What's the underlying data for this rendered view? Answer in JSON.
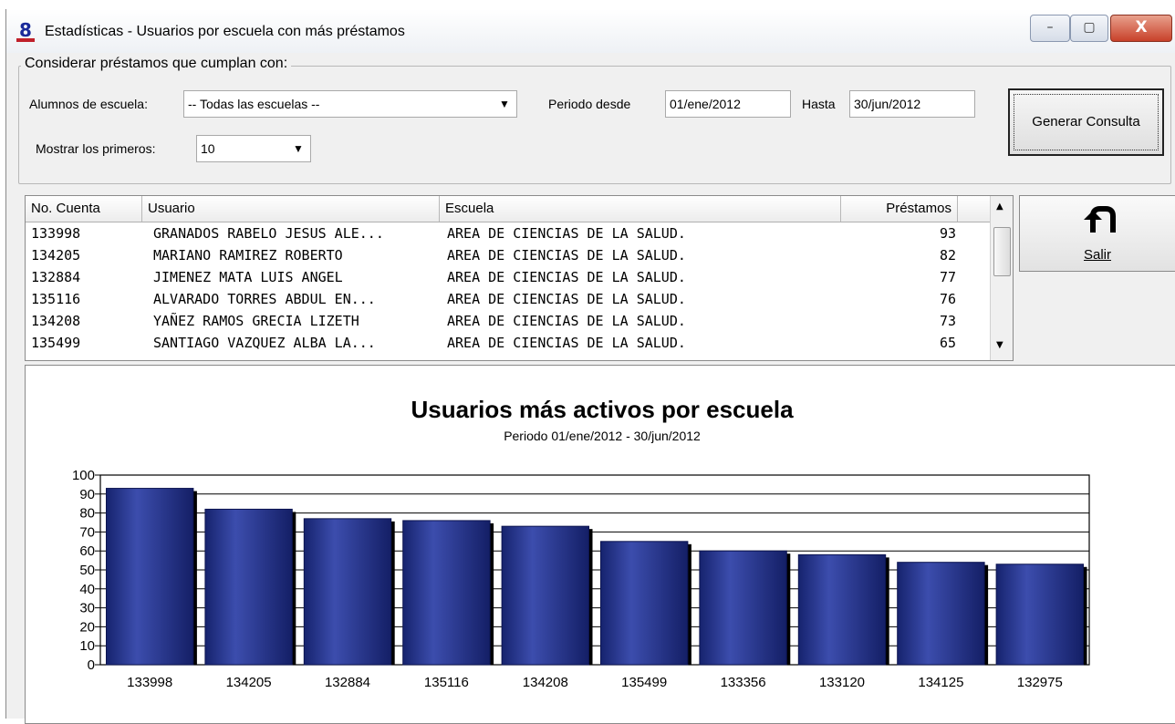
{
  "window": {
    "title": "Estadísticas - Usuarios por escuela con más préstamos",
    "minimize": "–",
    "maximize": "▢",
    "close": "X"
  },
  "filters": {
    "group_label": "Considerar préstamos que cumplan con:",
    "school_label": "Alumnos de escuela:",
    "school_value": "-- Todas las escuelas --",
    "period_from_label": "Periodo desde",
    "period_from_value": "01/ene/2012",
    "to_label": "Hasta",
    "to_value": "30/jun/2012",
    "show_first_label": "Mostrar los primeros:",
    "show_first_value": "10",
    "generate_button": "Generar Consulta"
  },
  "grid": {
    "columns": [
      "No. Cuenta",
      "Usuario",
      "Escuela",
      "Préstamos"
    ],
    "rows": [
      [
        "133998",
        "GRANADOS RABELO JESUS ALE...",
        "AREA DE CIENCIAS DE LA SALUD.",
        "93"
      ],
      [
        "134205",
        "MARIANO RAMIREZ ROBERTO",
        "AREA DE CIENCIAS DE LA SALUD.",
        "82"
      ],
      [
        "132884",
        "JIMENEZ MATA LUIS ANGEL",
        "AREA DE CIENCIAS DE LA SALUD.",
        "77"
      ],
      [
        "135116",
        "ALVARADO TORRES ABDUL EN...",
        "AREA DE CIENCIAS DE LA SALUD.",
        "76"
      ],
      [
        "134208",
        "YAÑEZ RAMOS GRECIA LIZETH",
        "AREA DE CIENCIAS DE LA SALUD.",
        "73"
      ],
      [
        "135499",
        "SANTIAGO VAZQUEZ ALBA LA...",
        "AREA DE CIENCIAS DE LA SALUD.",
        "65"
      ]
    ]
  },
  "exit_button": {
    "label": "Salir",
    "icon": "return-arrow-icon"
  },
  "chart_data": {
    "type": "bar",
    "title": "Usuarios más activos por escuela",
    "subtitle": "Periodo 01/ene/2012 - 30/jun/2012",
    "xlabel": "",
    "ylabel": "",
    "ylim": [
      0,
      100
    ],
    "y_ticks": [
      0,
      10,
      20,
      30,
      40,
      50,
      60,
      70,
      80,
      90,
      100
    ],
    "categories": [
      "133998",
      "134205",
      "132884",
      "135116",
      "134208",
      "135499",
      "133356",
      "133120",
      "134125",
      "132975"
    ],
    "values": [
      93,
      82,
      77,
      76,
      73,
      65,
      60,
      58,
      54,
      53
    ],
    "bar_color": "#1f2f8c",
    "grid": true
  }
}
